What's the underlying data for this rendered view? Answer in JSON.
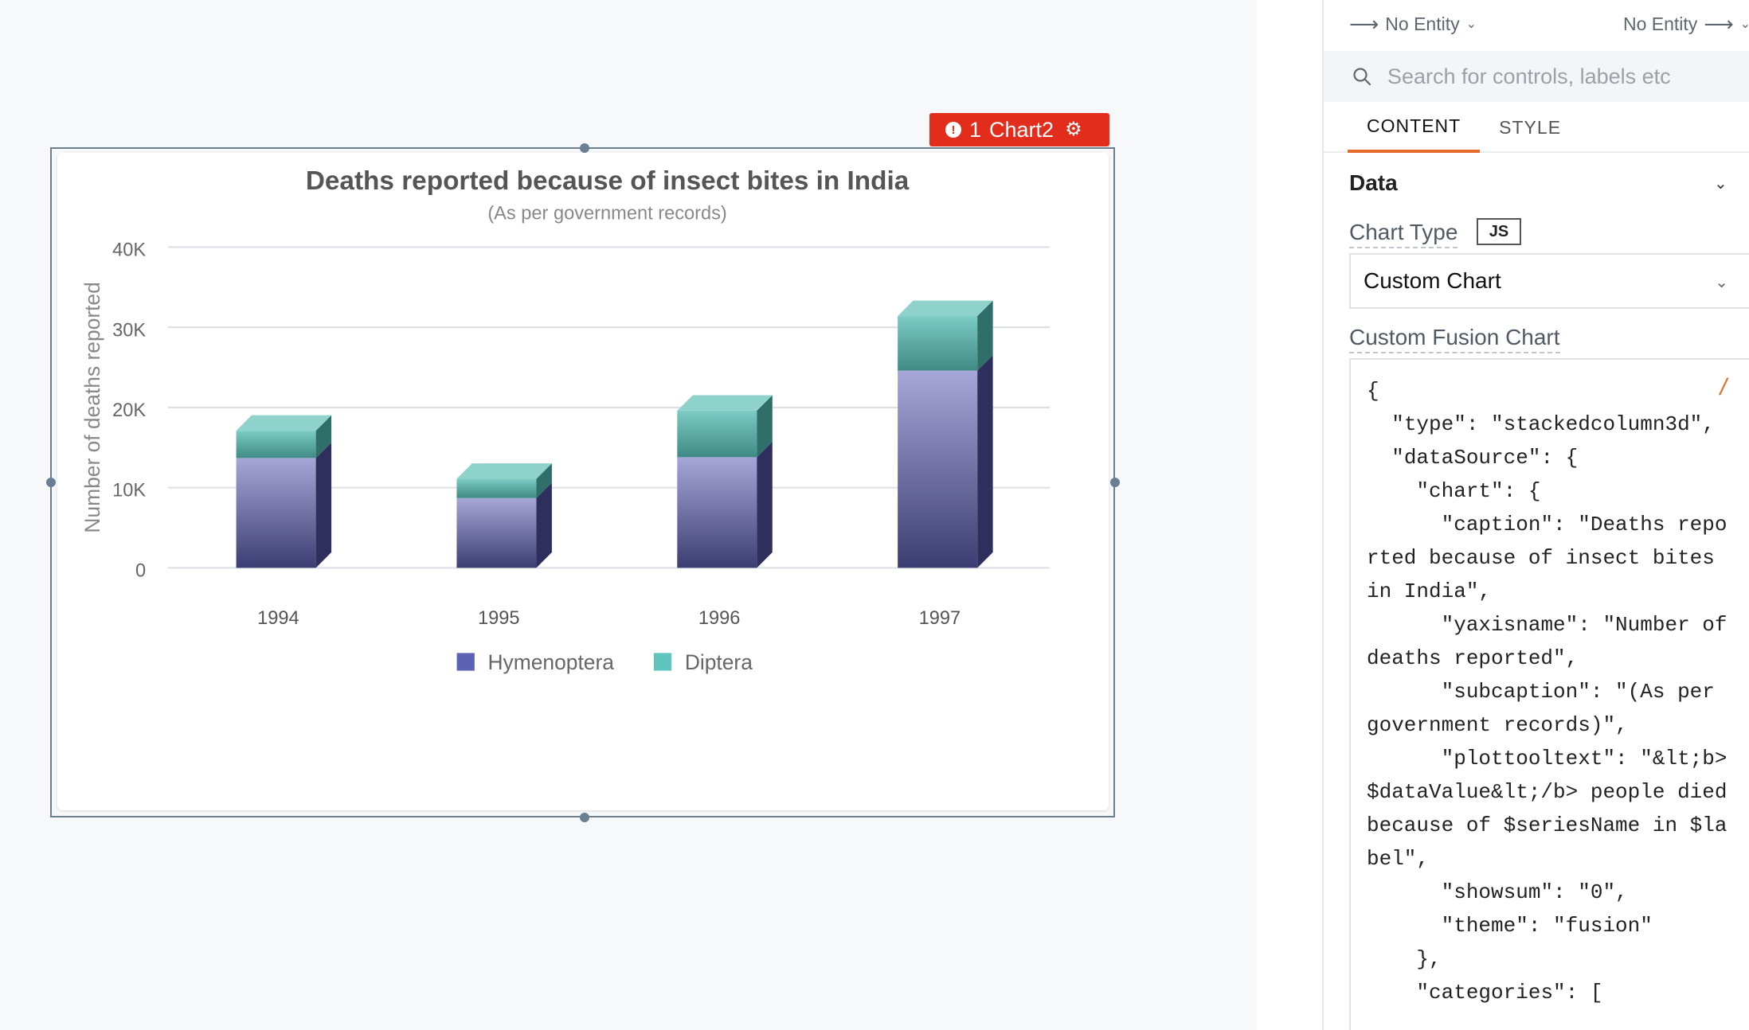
{
  "widget": {
    "error_count": "1",
    "name": "Chart2"
  },
  "colors": {
    "error_badge": "#e22c1c",
    "hymenoptera": "#5d62b5",
    "diptera": "#5ec4bd",
    "tab_accent": "#e56a2c"
  },
  "chart_data": {
    "type": "bar",
    "stacked": true,
    "three_d": true,
    "title": "Deaths reported because of insect bites in India",
    "subtitle": "(As per government records)",
    "ylabel": "Number of deaths reported",
    "xlabel": "",
    "categories": [
      "1994",
      "1995",
      "1996",
      "1997"
    ],
    "series": [
      {
        "name": "Hymenoptera",
        "values": [
          13700,
          8700,
          13800,
          24600
        ]
      },
      {
        "name": "Diptera",
        "values": [
          3400,
          2400,
          5800,
          6800
        ]
      }
    ],
    "ylim": [
      0,
      40000
    ],
    "yticks": [
      "0",
      "10K",
      "20K",
      "30K",
      "40K"
    ],
    "grid": true,
    "legend_position": "bottom"
  },
  "panel": {
    "entity_left": "No Entity",
    "entity_right": "No Entity",
    "search_placeholder": "Search for controls, labels etc",
    "tabs": [
      {
        "label": "CONTENT",
        "active": true
      },
      {
        "label": "STYLE",
        "active": false
      }
    ],
    "section_title": "Data",
    "chart_type_label": "Chart Type",
    "js_label": "JS",
    "chart_type_value": "Custom Chart",
    "custom_chart_label": "Custom Fusion Chart",
    "code": "{\n  \"type\": \"stackedcolumn3d\",\n  \"dataSource\": {\n    \"chart\": {\n      \"caption\": \"Deaths reported because of insect bites in India\",\n      \"yaxisname\": \"Number of deaths reported\",\n      \"subcaption\": \"(As per government records)\",\n      \"plottooltext\": \"&lt;b>$dataValue&lt;/b> people died because of $seriesName in $label\",\n      \"showsum\": \"0\",\n      \"theme\": \"fusion\"\n    },\n    \"categories\": [",
    "code_slash": "/"
  }
}
